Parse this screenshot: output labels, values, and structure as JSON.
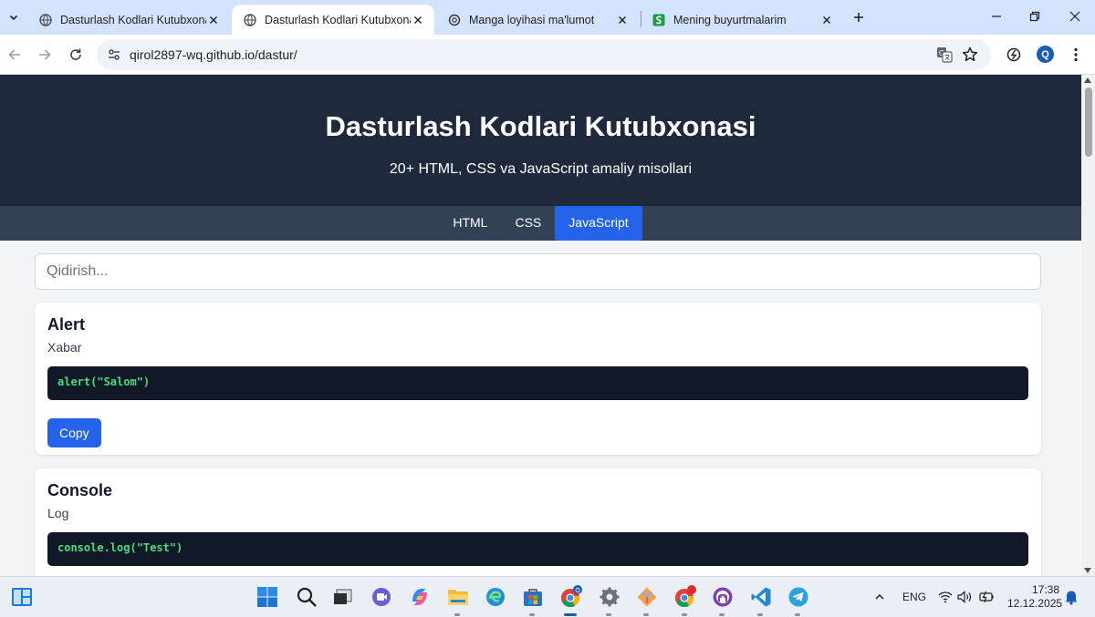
{
  "browser": {
    "tabs": [
      {
        "title": "Dasturlash Kodlari Kutubxonasi",
        "icon": "globe-icon",
        "active": false
      },
      {
        "title": "Dasturlash Kodlari Kutubxonasi",
        "icon": "globe-icon",
        "active": true
      },
      {
        "title": "Manga loyihasi ma'lumot",
        "icon": "chatgpt-icon",
        "active": false
      },
      {
        "title": "Mening buyurtmalarim",
        "icon": "green-s-icon",
        "active": false
      }
    ],
    "url": "qirol2897-wq.github.io/dastur/",
    "profile_initial": "Q"
  },
  "page": {
    "header": {
      "title": "Dasturlash Kodlari Kutubxonasi",
      "subtitle": "20+ HTML, CSS va JavaScript amaliy misollari"
    },
    "nav": [
      {
        "label": "HTML",
        "active": false
      },
      {
        "label": "CSS",
        "active": false
      },
      {
        "label": "JavaScript",
        "active": true
      }
    ],
    "search": {
      "placeholder": "Qidirish...",
      "value": ""
    },
    "cards": [
      {
        "title": "Alert",
        "description": "Xabar",
        "code": "alert(\"Salom\")",
        "button_label": "Copy"
      },
      {
        "title": "Console",
        "description": "Log",
        "code": "console.log(\"Test\")"
      }
    ],
    "colors": {
      "header_bg": "#1e293b",
      "nav_bg": "#334155",
      "accent": "#2563eb",
      "code_bg": "#111827",
      "code_text": "#4ade80"
    }
  },
  "taskbar": {
    "apps": [
      "start-icon",
      "search-icon",
      "task-view-icon",
      "meet-icon",
      "copilot-icon",
      "file-explorer-icon",
      "edge-icon",
      "store-icon",
      "chrome-icon",
      "settings-icon",
      "git-icon",
      "chrome-profile-icon",
      "github-desktop-icon",
      "vscode-icon",
      "telegram-icon"
    ],
    "chrome_badge": "Q",
    "language": "ENG",
    "time": "17:38",
    "date": "12.12.2025"
  }
}
